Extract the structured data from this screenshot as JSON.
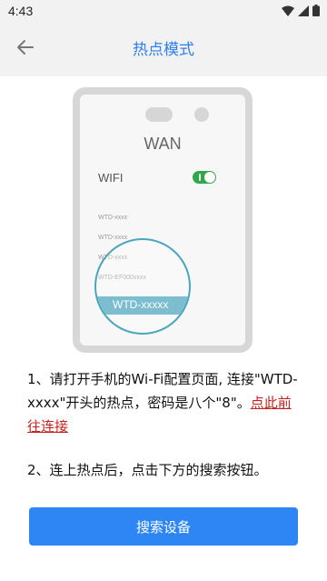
{
  "status_bar": {
    "time": "4:43",
    "icons": [
      "wifi-icon",
      "signal-icon",
      "battery-icon"
    ]
  },
  "header": {
    "title": "热点模式",
    "back_icon": "arrow-left-icon"
  },
  "illustration": {
    "wan_label": "WAN",
    "wifi_label": "WIFI",
    "toggle_on": true,
    "networks": [
      "WTD-xxxx",
      "WTD-xxxx",
      "WTD-xxxx",
      "WTD-EF000xxxx"
    ],
    "highlighted_network": "WTD-xxxxx"
  },
  "instructions": {
    "step1_text": "1、请打开手机的Wi-Fi配置页面, 连接\"WTD-xxxx\"开头的热点，密码是八个\"8\"。",
    "step1_link": "点此前往连接",
    "step2_text": "2、连上热点后，点击下方的搜索按钮。"
  },
  "search_button": {
    "label": "搜索设备"
  },
  "colors": {
    "accent": "#2e86f5",
    "title": "#2e7ff0",
    "link": "#c8201c",
    "toggle": "#2fa84a"
  }
}
